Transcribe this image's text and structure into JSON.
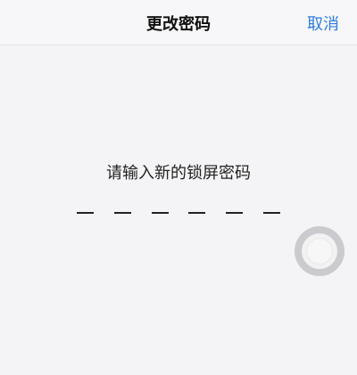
{
  "navbar": {
    "title": "更改密码",
    "cancel_label": "取消"
  },
  "prompt": {
    "text": "请输入新的锁屏密码"
  },
  "passcode": {
    "length": 6,
    "entered": 0
  },
  "assistive_touch": {
    "icon": "assistive-touch-icon"
  },
  "colors": {
    "accent": "#2f7de1",
    "background": "#f4f4f6"
  }
}
